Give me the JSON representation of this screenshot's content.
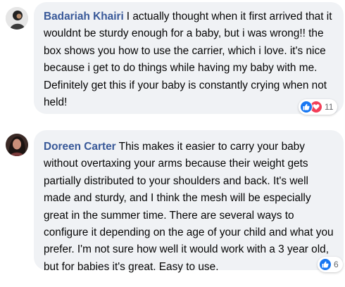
{
  "comments": [
    {
      "author": "Badariah Khairi",
      "text": "I actually thought when it first arrived that it wouldnt be sturdy enough for a baby, but i was wrong!! the box shows you how to use the carrier, which i love. it's nice because i get to do things while having my baby with me. Definitely get this if your baby is constantly crying when not held!",
      "reactions": {
        "icons": [
          "like-icon",
          "love-icon"
        ],
        "count": "11"
      }
    },
    {
      "author": "Doreen Carter",
      "text": "This makes it easier to carry your baby without overtaxing your arms because their weight gets partially distributed to your shoulders and back. It's well made and sturdy, and I think the mesh will be especially great in the summer time. There are several ways to configure it depending on the age of your child and what you prefer. I'm not sure how well it would work with a 3 year old, but for babies it's great. Easy to use.",
      "reactions": {
        "icons": [
          "like-icon"
        ],
        "count": "6"
      }
    }
  ],
  "colors": {
    "author": "#385898",
    "bubble": "#f0f2f5",
    "like": "#1877f2",
    "love": "#f33e58"
  }
}
